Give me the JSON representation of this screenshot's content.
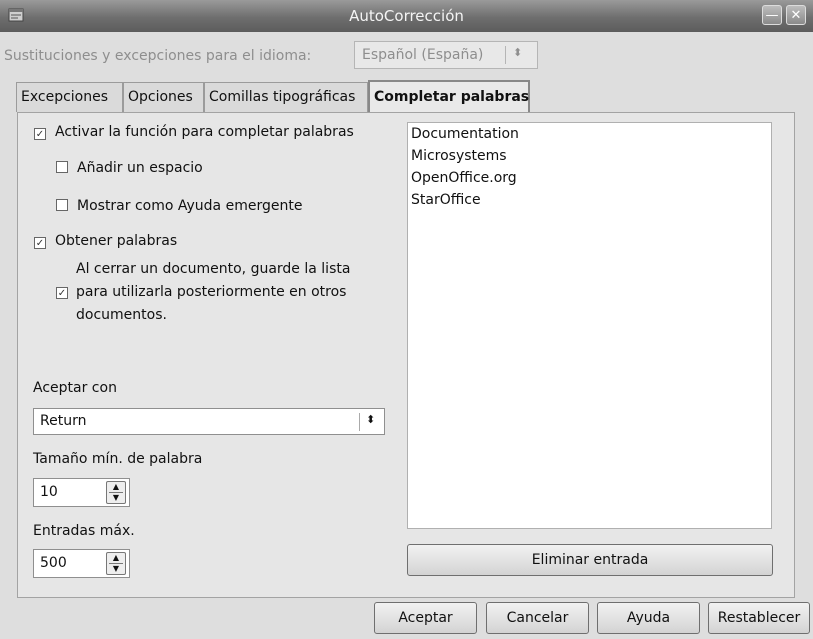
{
  "window": {
    "title": "AutoCorrección",
    "minimize_glyph": "—",
    "close_glyph": "✕"
  },
  "language": {
    "label": "Sustituciones y excepciones para el idioma:",
    "value": "Español (España)"
  },
  "tabs": [
    {
      "label": "Excepciones"
    },
    {
      "label": "Opciones"
    },
    {
      "label": "Comillas tipográficas"
    },
    {
      "label": "Completar palabras"
    }
  ],
  "options": {
    "enable_completion": {
      "label": "Activar la función para completar palabras",
      "checked": true
    },
    "append_space": {
      "label": "Añadir un espacio",
      "checked": false
    },
    "show_as_tip": {
      "label": "Mostrar como Ayuda emergente",
      "checked": false
    },
    "collect_words": {
      "label": "Obtener palabras",
      "checked": true
    },
    "keep_list": {
      "line1": "Al cerrar un documento, guarde la lista",
      "line2": "para utilizarla posteriormente en otros",
      "line3": "documentos.",
      "checked": true
    }
  },
  "accept_with": {
    "label": "Aceptar con",
    "value": "Return"
  },
  "min_word_length": {
    "label": "Tamaño mín. de palabra",
    "value": "10"
  },
  "max_entries": {
    "label": "Entradas máx.",
    "value": "500"
  },
  "word_list": [
    "Documentation",
    "Microsystems",
    "OpenOffice.org",
    "StarOffice"
  ],
  "buttons": {
    "delete_entry": "Eliminar entrada",
    "ok": "Aceptar",
    "cancel": "Cancelar",
    "help": "Ayuda",
    "reset": "Restablecer"
  },
  "icons": {
    "window": "app-window-icon",
    "checkmark": "✓",
    "spin_up": "▲",
    "spin_down": "▼",
    "combo_arrows": "⬍"
  }
}
